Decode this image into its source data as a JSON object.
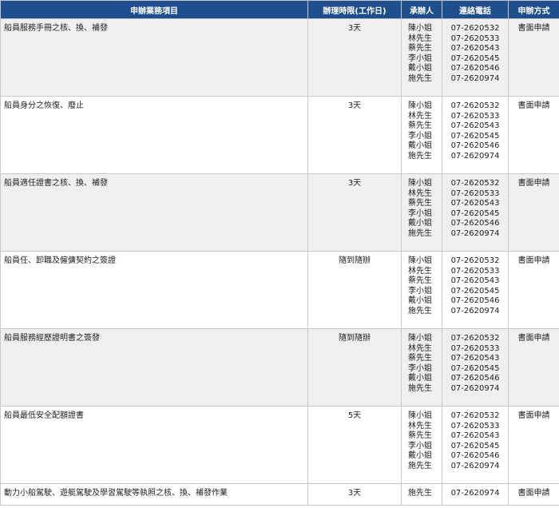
{
  "headers": [
    "申辦業務項目",
    "辦理時限(工作日)",
    "承辦人",
    "連絡電話",
    "申辦方式"
  ],
  "rows": [
    {
      "item": "船員服務手冊之核、換、補發",
      "time": "3天",
      "contacts": [
        "陳小姐",
        "林先生",
        "蔡先生",
        "李小姐",
        "戴小姐",
        "施先生"
      ],
      "phones": [
        "07-2620532",
        "07-2620533",
        "07-2620543",
        "07-2620545",
        "07-2620546",
        "07-2620974"
      ],
      "method": "書面申請"
    },
    {
      "item": "船員身分之恢復、廢止",
      "time": "3天",
      "contacts": [
        "陳小姐",
        "林先生",
        "蔡先生",
        "李小姐",
        "戴小姐",
        "施先生"
      ],
      "phones": [
        "07-2620532",
        "07-2620533",
        "07-2620543",
        "07-2620545",
        "07-2620546",
        "07-2620974"
      ],
      "method": "書面申請"
    },
    {
      "item": "船員適任證書之核、換、補發",
      "time": "3天",
      "contacts": [
        "陳小姐",
        "林先生",
        "蔡先生",
        "李小姐",
        "戴小姐",
        "施先生"
      ],
      "phones": [
        "07-2620532",
        "07-2620533",
        "07-2620543",
        "07-2620545",
        "07-2620546",
        "07-2620974"
      ],
      "method": "書面申請"
    },
    {
      "item": "船員任、卸職及僱傭契約之簽證",
      "time": "隨到隨辦",
      "contacts": [
        "陳小姐",
        "林先生",
        "蔡先生",
        "李小姐",
        "戴小姐",
        "施先生"
      ],
      "phones": [
        "07-2620532",
        "07-2620533",
        "07-2620543",
        "07-2620545",
        "07-2620546",
        "07-2620974"
      ],
      "method": "書面申請"
    },
    {
      "item": "船員服務經歷證明書之簽發",
      "time": "隨到隨辦",
      "contacts": [
        "陳小姐",
        "林先生",
        "蔡先生",
        "李小姐",
        "戴小姐",
        "施先生"
      ],
      "phones": [
        "07-2620532",
        "07-2620533",
        "07-2620543",
        "07-2620545",
        "07-2620546",
        "07-2620974"
      ],
      "method": "書面申請"
    },
    {
      "item": "船員最低安全配額證書",
      "time": "5天",
      "contacts": [
        "陳小姐",
        "林先生",
        "蔡先生",
        "李小姐",
        "戴小姐",
        "施先生"
      ],
      "phones": [
        "07-2620532",
        "07-2620533",
        "07-2620543",
        "07-2620545",
        "07-2620546",
        "07-2620974"
      ],
      "method": "書面申請"
    },
    {
      "item": "動力小船駕駛、遊艇駕駛及學習駕駛等執照之核、換、補發作業",
      "time": "3天",
      "contacts": [
        "施先生"
      ],
      "phones": [
        "07-2620974"
      ],
      "method": "書面申請"
    }
  ]
}
